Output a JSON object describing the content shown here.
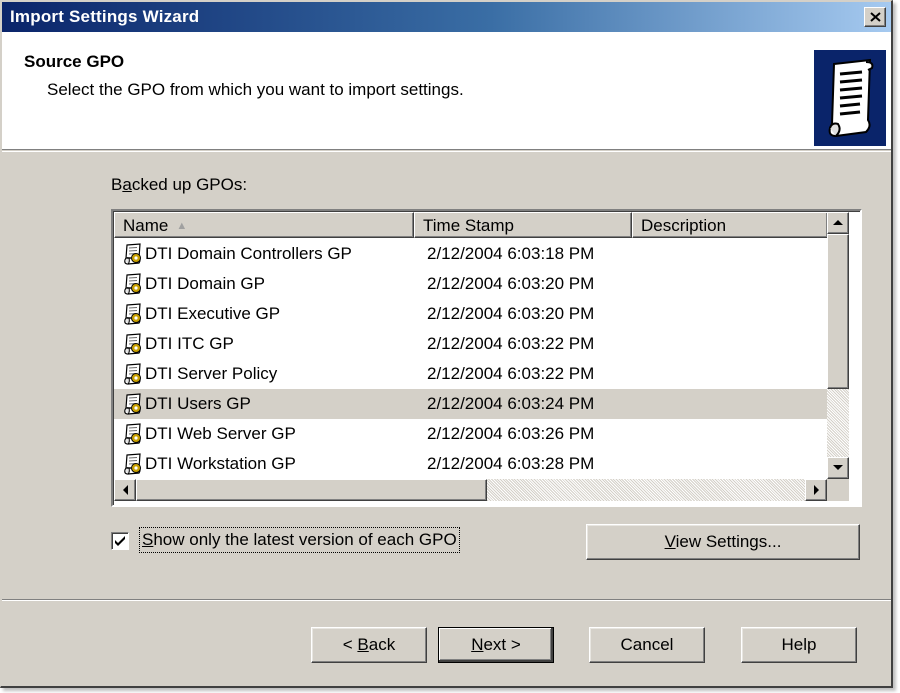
{
  "window": {
    "title": "Import Settings Wizard"
  },
  "header": {
    "title": "Source GPO",
    "subtitle": "Select the GPO from which you want to import settings."
  },
  "list": {
    "label_pre": "B",
    "label_accel": "a",
    "label_post": "cked up GPOs:",
    "columns": [
      "Name",
      "Time Stamp",
      "Description"
    ],
    "selected_row": 5,
    "rows": [
      {
        "name": "DTI Domain Controllers GP",
        "timestamp": "2/12/2004 6:03:18 PM",
        "description": ""
      },
      {
        "name": "DTI Domain GP",
        "timestamp": "2/12/2004 6:03:20 PM",
        "description": ""
      },
      {
        "name": "DTI Executive GP",
        "timestamp": "2/12/2004 6:03:20 PM",
        "description": ""
      },
      {
        "name": "DTI ITC GP",
        "timestamp": "2/12/2004 6:03:22 PM",
        "description": ""
      },
      {
        "name": "DTI Server Policy",
        "timestamp": "2/12/2004 6:03:22 PM",
        "description": ""
      },
      {
        "name": "DTI Users GP",
        "timestamp": "2/12/2004 6:03:24 PM",
        "description": ""
      },
      {
        "name": "DTI Web Server GP",
        "timestamp": "2/12/2004 6:03:26 PM",
        "description": ""
      },
      {
        "name": "DTI Workstation GP",
        "timestamp": "2/12/2004 6:03:28 PM",
        "description": ""
      }
    ]
  },
  "options": {
    "latest_only_accel": "S",
    "latest_only_rest": "how only the latest version of each GPO",
    "latest_only_checked": true
  },
  "buttons": {
    "view_settings_accel": "V",
    "view_settings_rest": "iew Settings...",
    "back_pre": "< ",
    "back_accel": "B",
    "back_rest": "ack",
    "next_accel": "N",
    "next_rest": "ext >",
    "cancel": "Cancel",
    "help": "Help"
  },
  "icons": {
    "title_close": "close-icon",
    "wizard": "scroll-icon",
    "gpo": "gpo-scroll-icon",
    "sort": "sort-ascending-icon"
  },
  "colors": {
    "title_gradient_start": "#0a246a",
    "title_gradient_end": "#a6caf0",
    "face": "#d4d0c8",
    "selected_row": "#d4d0c8"
  }
}
